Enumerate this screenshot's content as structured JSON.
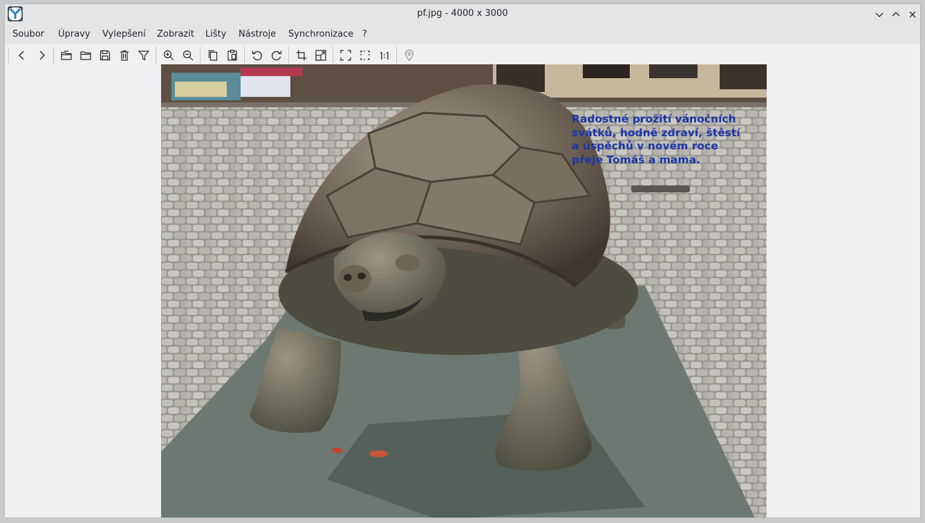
{
  "window": {
    "title": "pf.jpg - 4000 x 3000",
    "controls": [
      "minimize-icon",
      "maximize-icon",
      "close-icon"
    ]
  },
  "menu": {
    "items": [
      "Soubor",
      "Úpravy",
      "Vylepšení",
      "Zobrazit",
      "Lišty",
      "Nástroje",
      "Synchronizace",
      "?"
    ]
  },
  "toolbar": {
    "buttons": [
      "previous-icon",
      "next-icon",
      "open-recent-icon",
      "open-folder-icon",
      "save-icon",
      "delete-icon",
      "filter-icon",
      "zoom-in-icon",
      "zoom-out-icon",
      "copy-icon",
      "paste-icon",
      "rotate-left-icon",
      "rotate-right-icon",
      "crop-icon",
      "resize-icon",
      "fullscreen-icon",
      "fit-window-icon",
      "actual-size-icon",
      "location-icon"
    ],
    "actual_size_label": "1:1"
  },
  "image": {
    "greeting_lines": [
      "Radostné prožití vánočních",
      "svátků, hodně zdraví, štěstí",
      "a úspěchů v novém roce",
      "přeje Tomáš a mama."
    ]
  },
  "colors": {
    "chrome": "#e3e5e7",
    "background": "#eff0f1",
    "text": "#232629",
    "greeting_text": "#1e34a8",
    "accent": "#2980b9"
  }
}
